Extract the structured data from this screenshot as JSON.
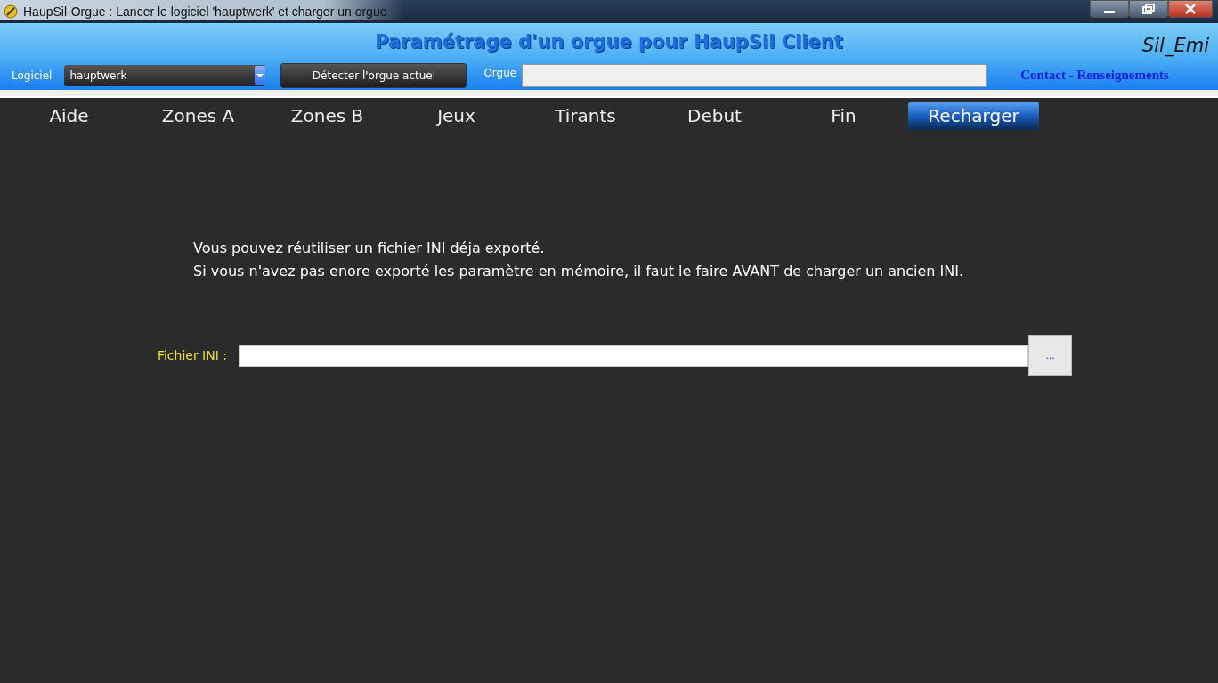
{
  "window": {
    "title": "HaupSil-Orgue  :  Lancer le logiciel 'hauptwerk' et charger un orgue"
  },
  "header": {
    "title": "Paramétrage d'un orgue pour HaupSil Client",
    "user": "Sil_Emi"
  },
  "toolbar": {
    "software_label": "Logiciel",
    "software_value": "hauptwerk",
    "detect_button": "Détecter l'orgue actuel",
    "organ_label": "Orgue",
    "contact_link": "Contact - Renseignements"
  },
  "tabs": [
    {
      "label": "Aide",
      "selected": false
    },
    {
      "label": "Zones A",
      "selected": false
    },
    {
      "label": "Zones B",
      "selected": false
    },
    {
      "label": "Jeux",
      "selected": false
    },
    {
      "label": "Tirants",
      "selected": false
    },
    {
      "label": "Debut",
      "selected": false
    },
    {
      "label": "Fin",
      "selected": false
    },
    {
      "label": "Recharger",
      "selected": true
    }
  ],
  "content": {
    "lines": [
      "Vous pouvez réutiliser un fichier INI déja exporté.",
      "Si vous n'avez pas enore exporté les paramètre en mémoire, il faut le faire AVANT de charger un ancien INI."
    ],
    "file_label": "Fichier INI :",
    "browse_button": "..."
  }
}
